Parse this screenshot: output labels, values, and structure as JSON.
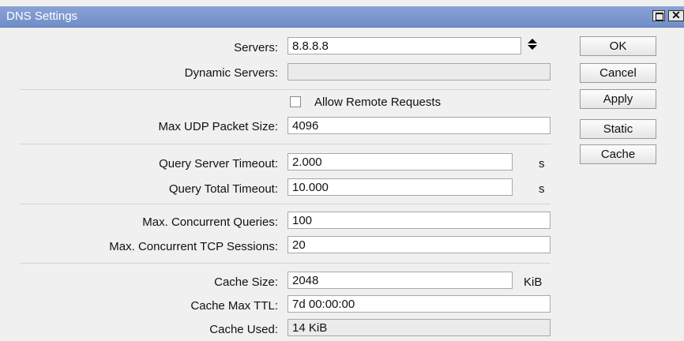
{
  "window": {
    "title": "DNS Settings"
  },
  "form": {
    "servers_label": "Servers:",
    "servers_value": "8.8.8.8",
    "dynamic_servers_label": "Dynamic Servers:",
    "dynamic_servers_value": "",
    "allow_remote_label": "Allow Remote Requests",
    "allow_remote_checked": false,
    "max_udp_label": "Max UDP Packet Size:",
    "max_udp_value": "4096",
    "query_server_timeout_label": "Query Server Timeout:",
    "query_server_timeout_value": "2.000",
    "query_server_timeout_unit": "s",
    "query_total_timeout_label": "Query Total Timeout:",
    "query_total_timeout_value": "10.000",
    "query_total_timeout_unit": "s",
    "max_concurrent_queries_label": "Max. Concurrent Queries:",
    "max_concurrent_queries_value": "100",
    "max_tcp_sessions_label": "Max. Concurrent TCP Sessions:",
    "max_tcp_sessions_value": "20",
    "cache_size_label": "Cache Size:",
    "cache_size_value": "2048",
    "cache_size_unit": "KiB",
    "cache_max_ttl_label": "Cache Max TTL:",
    "cache_max_ttl_value": "7d 00:00:00",
    "cache_used_label": "Cache Used:",
    "cache_used_value": "14 KiB"
  },
  "buttons": {
    "ok": "OK",
    "cancel": "Cancel",
    "apply": "Apply",
    "static": "Static",
    "cache": "Cache"
  },
  "icons": {
    "restore": "restore-icon",
    "close": "close-icon",
    "spinner": "up-down-arrows-icon"
  }
}
